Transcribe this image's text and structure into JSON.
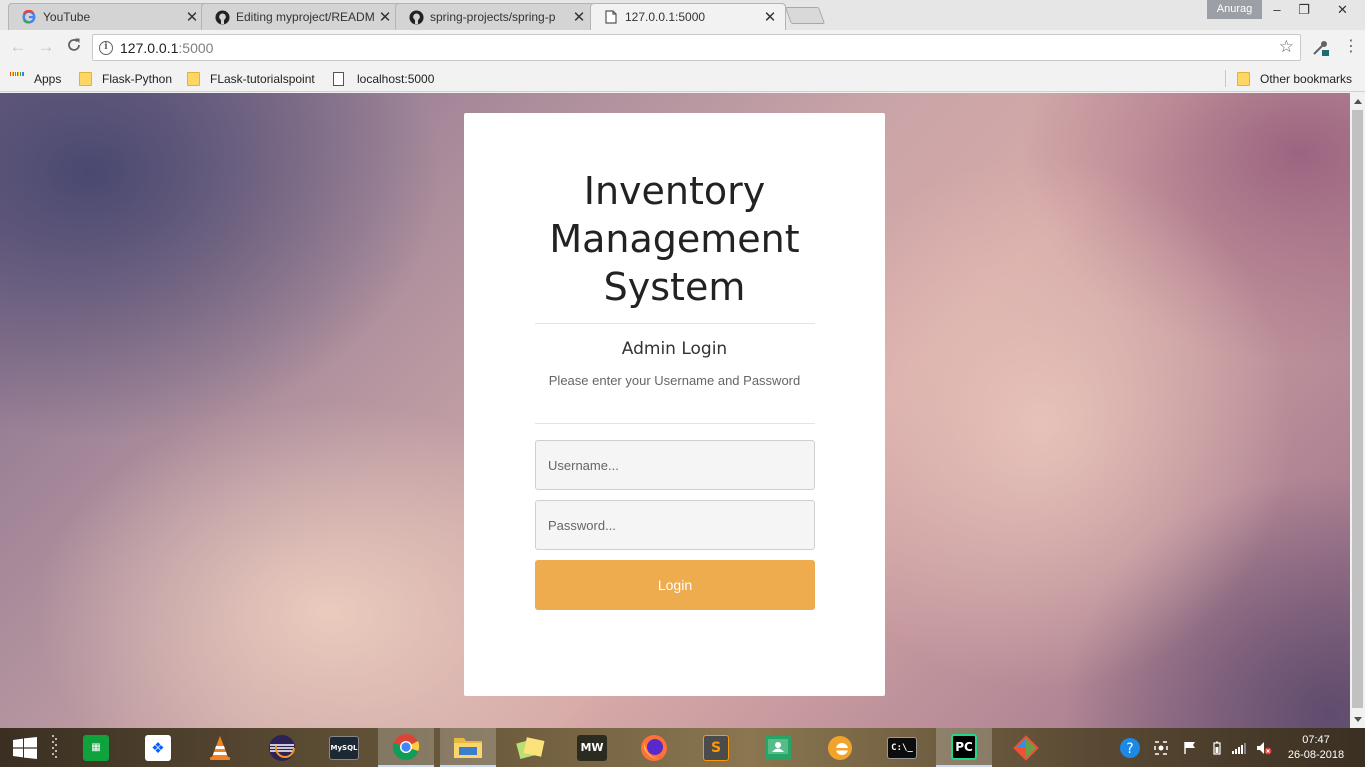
{
  "browser": {
    "tabs": [
      {
        "title": "YouTube",
        "favicon": "google-icon",
        "active": false
      },
      {
        "title": "Editing myproject/READM",
        "favicon": "github-icon",
        "active": false
      },
      {
        "title": "spring-projects/spring-p",
        "favicon": "github-icon",
        "active": false
      },
      {
        "title": "127.0.0.1:5000",
        "favicon": "page-icon",
        "active": true
      }
    ],
    "profile_name": "Anurag",
    "address": {
      "host": "127.0.0.1",
      "port": ":5000"
    },
    "bookmarks": [
      {
        "label": "Apps",
        "icon": "apps-grid-icon"
      },
      {
        "label": "Flask-Python",
        "icon": "folder-icon"
      },
      {
        "label": "FLask-tutorialspoint",
        "icon": "folder-icon"
      },
      {
        "label": "localhost:5000",
        "icon": "page-icon"
      }
    ],
    "other_bookmarks": "Other bookmarks"
  },
  "login": {
    "title_line1": "Inventory",
    "title_line2": "Management",
    "title_line3": "System",
    "subtitle": "Admin Login",
    "hint": "Please enter your Username and Password",
    "username_placeholder": "Username...",
    "password_placeholder": "Password...",
    "button_label": "Login",
    "button_color": "#efac4e"
  },
  "taskbar": {
    "apps": [
      "start-icon",
      "task-view-icon",
      "store-icon",
      "dropbox-icon",
      "vlc-icon",
      "eclipse-icon",
      "mysql-icon",
      "chrome-icon",
      "file-explorer-icon",
      "sticky-notes-icon",
      "nfs-mw-icon",
      "firefox-icon",
      "sublime-icon",
      "classroom-icon",
      "edge-icon",
      "cmd-icon",
      "pycharm-icon",
      "git-icon"
    ],
    "nfs_label": "MW",
    "pycharm_label": "PC",
    "sublime_label": "S",
    "time": "07:47",
    "date": "26-08-2018"
  }
}
